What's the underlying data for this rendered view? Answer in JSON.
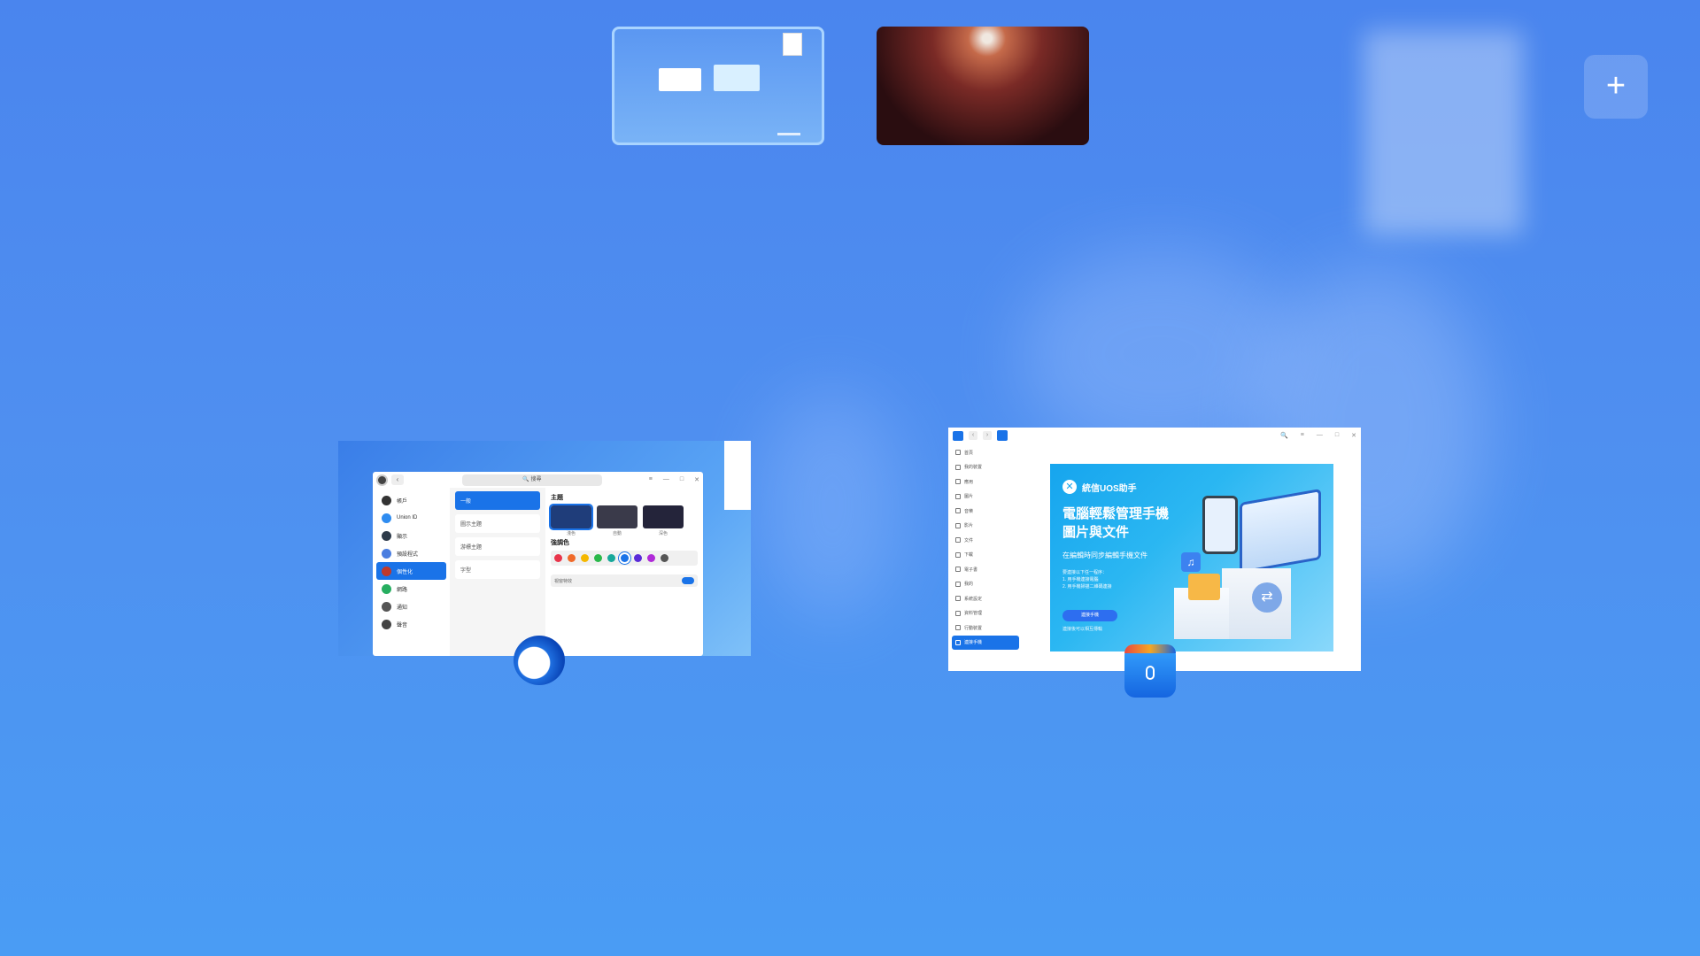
{
  "workspaces": {
    "items": [
      {
        "name": "workspace-1",
        "active": true
      },
      {
        "name": "workspace-2",
        "active": false
      }
    ],
    "add_label": "+"
  },
  "settings_window": {
    "search_text": "🔍 搜尋",
    "controls": [
      "≡",
      "—",
      "□",
      "✕"
    ],
    "nav_back": "‹",
    "sidebar": [
      {
        "label": "帳戶",
        "active": false,
        "color": "#333333"
      },
      {
        "label": "Union ID",
        "active": false,
        "color": "#2f8cf0"
      },
      {
        "label": "顯示",
        "active": false,
        "color": "#2e3b4a"
      },
      {
        "label": "預設程式",
        "active": false,
        "color": "#4a7ee0"
      },
      {
        "label": "個性化",
        "active": true,
        "color": "#c0392b"
      },
      {
        "label": "網路",
        "active": false,
        "color": "#27ae60"
      },
      {
        "label": "通知",
        "active": false,
        "color": "#555555"
      },
      {
        "label": "聲音",
        "active": false,
        "color": "#444444"
      }
    ],
    "subsections": [
      {
        "label": "一般",
        "active": true
      },
      {
        "label": "圖示主題",
        "active": false
      },
      {
        "label": "游標主題",
        "active": false
      },
      {
        "label": "字型",
        "active": false
      }
    ],
    "theme_title": "主題",
    "themes": [
      {
        "label": "淺色",
        "color": "#1f3d7a"
      },
      {
        "label": "自動",
        "color": "#3a3a4a"
      },
      {
        "label": "深色",
        "color": "#24243a"
      }
    ],
    "accent_title": "強調色",
    "accent_colors": [
      "#e8344a",
      "#f06a2a",
      "#f5b800",
      "#2ab84a",
      "#17a89a",
      "#1a73e8",
      "#5a2ad8",
      "#b02ad8",
      "#555555"
    ],
    "effects_label": "視窗特效"
  },
  "assistant_window": {
    "controls": [
      "🔍",
      "≡",
      "—",
      "□",
      "✕"
    ],
    "nav": [
      "‹",
      "›"
    ],
    "sidebar": [
      {
        "label": "首頁",
        "active": false
      },
      {
        "label": "我的裝置",
        "active": false
      },
      {
        "label": "應用",
        "active": false
      },
      {
        "label": "圖片",
        "active": false
      },
      {
        "label": "音樂",
        "active": false
      },
      {
        "label": "影片",
        "active": false
      },
      {
        "label": "文件",
        "active": false
      },
      {
        "label": "下載",
        "active": false
      },
      {
        "label": "電子書",
        "active": false
      },
      {
        "label": "我的",
        "active": false
      },
      {
        "label": "系統設定",
        "active": false
      },
      {
        "label": "資料管理",
        "active": false
      },
      {
        "label": "行動裝置",
        "active": false
      },
      {
        "label": "連接手機",
        "active": true
      }
    ],
    "banner": {
      "brand": "統信UOS助手",
      "headline_1": "電腦輕鬆管理手機",
      "headline_2": "圖片與文件",
      "subtitle": "在編輯時同步編輯手機文件",
      "steps_intro": "要連接以下任一程序：",
      "step_1": "1. 用手機連接電腦",
      "step_2": "2. 用手機掃描二維碼連接",
      "cta": "連接手機",
      "hint": "連接後可以相互傳輸"
    }
  }
}
